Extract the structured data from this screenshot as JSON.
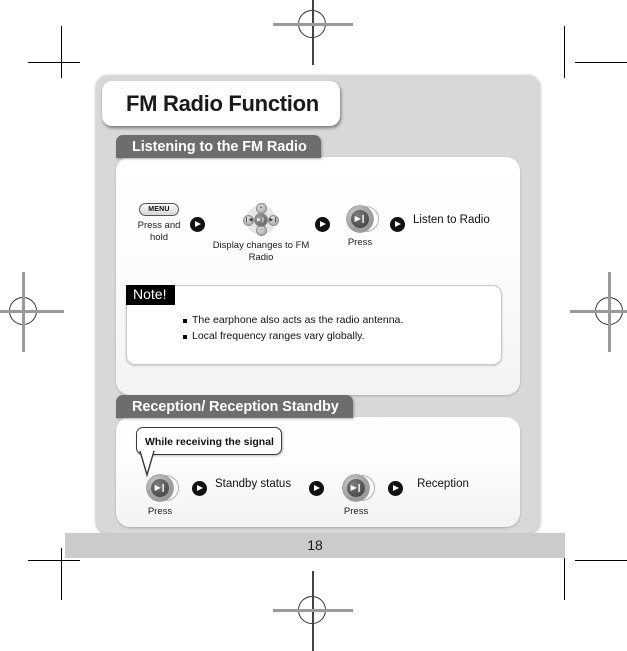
{
  "document": {
    "chapter_title": "FM Radio Function",
    "page_number": "18"
  },
  "sections": [
    {
      "id": "listening",
      "heading": "Listening to the FM Radio",
      "steps": [
        {
          "icon": "menu-pill",
          "icon_label": "MENU",
          "caption": "Press and hold"
        },
        {
          "icon": "dpad",
          "caption": "Display changes to FM Radio",
          "dpad": {
            "center": "▶❙",
            "up": "+",
            "down": "−",
            "left": "❙◀",
            "right": "▶❙"
          }
        },
        {
          "icon": "play-button",
          "icon_glyph": "▶❙",
          "caption": "Press"
        },
        {
          "icon": "text",
          "caption": "Listen to Radio"
        }
      ],
      "note": {
        "label": "Note!",
        "items": [
          "The earphone also acts as the radio antenna.",
          "Local frequency ranges vary globally."
        ]
      }
    },
    {
      "id": "reception",
      "heading": "Reception/ Reception Standby",
      "callout": "While receiving the signal",
      "steps": [
        {
          "icon": "play-button",
          "icon_glyph": "▶❙",
          "caption": "Press"
        },
        {
          "icon": "text",
          "caption": "Standby status"
        },
        {
          "icon": "play-button",
          "icon_glyph": "▶❙",
          "caption": "Press"
        },
        {
          "icon": "text",
          "caption": "Reception"
        }
      ]
    }
  ],
  "colors": {
    "sheet_background": "#d8d8d8",
    "section_tab": "#6d6d6d",
    "panel": "#ffffff",
    "note_label_background": "#000000",
    "footer_bar": "#cbcbcb",
    "arrow": "#111111"
  }
}
